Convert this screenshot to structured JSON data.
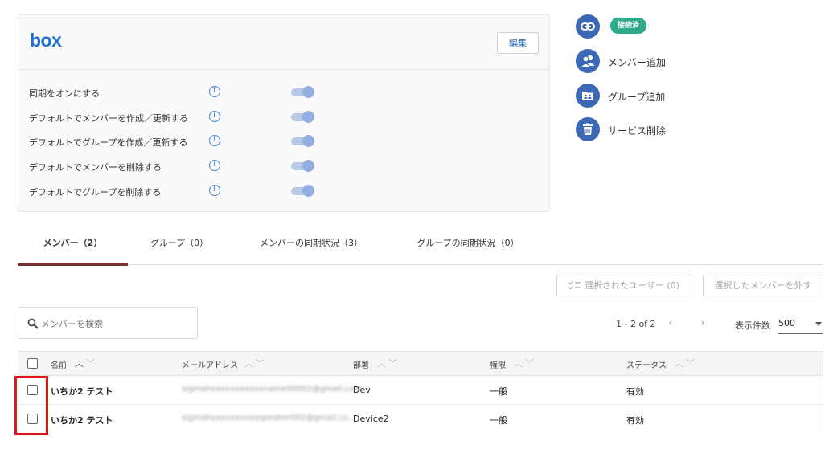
{
  "card": {
    "logo_text": "box",
    "edit_label": "編集",
    "settings": [
      {
        "label": "同期をオンにする",
        "enabled": true
      },
      {
        "label": "デフォルトでメンバーを作成／更新する",
        "enabled": true
      },
      {
        "label": "デフォルトでグループを作成／更新する",
        "enabled": true
      },
      {
        "label": "デフォルトでメンバーを削除する",
        "enabled": true
      },
      {
        "label": "デフォルトでグループを削除する",
        "enabled": true
      }
    ],
    "info_glyph": "i"
  },
  "side": {
    "status_badge": "接続済",
    "actions": [
      {
        "label": "メンバー追加",
        "icon": "people-icon"
      },
      {
        "label": "グループ追加",
        "icon": "group-folder-icon"
      },
      {
        "label": "サービス削除",
        "icon": "trash-icon"
      }
    ]
  },
  "tabs": [
    {
      "label": "メンバー（2）",
      "active": true
    },
    {
      "label": "グループ（0）",
      "active": false
    },
    {
      "label": "メンバーの同期状況（3）",
      "active": false
    },
    {
      "label": "グループの同期状況（0）",
      "active": false
    }
  ],
  "toolbar": {
    "selected_users_label": "選択されたユーザー (0)",
    "remove_members_label": "選択したメンバーを外す"
  },
  "search": {
    "placeholder": "メンバーを検索"
  },
  "pagination": {
    "range_text": "1 - 2 of 2",
    "prev_glyph": "‹",
    "next_glyph": "›",
    "per_page_label": "表示件数",
    "per_page_value": "500"
  },
  "table": {
    "columns": [
      "名前",
      "メールアドレス",
      "部署",
      "権限",
      "ステータス"
    ],
    "sort_glyphs": {
      "up": "︿",
      "down": "﹀"
    },
    "rows": [
      {
        "name": "いちか2 テスト",
        "email": "sigmahxxxxxxxxxxxname00002@gmail.com",
        "dept": "Dev",
        "role": "一般",
        "status": "有効"
      },
      {
        "name": "いちか2 テスト",
        "email": "sigmahxxxxxxxxxxspeaker002@gmail.co...",
        "dept": "Device2",
        "role": "一般",
        "status": "有効"
      }
    ]
  },
  "colors": {
    "accent": "#3d68b5",
    "tab_underline": "#7a2f2f",
    "badge": "#2faa8a",
    "highlight": "#e01818"
  }
}
